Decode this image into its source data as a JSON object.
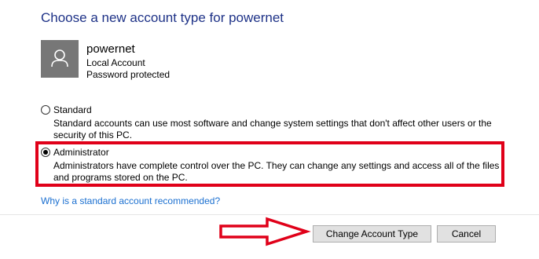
{
  "page": {
    "title": "Choose a new account type for powernet"
  },
  "user": {
    "name": "powernet",
    "account_type": "Local Account",
    "password_status": "Password protected",
    "avatar_icon": "user-silhouette-icon"
  },
  "options": {
    "standard": {
      "label": "Standard",
      "description": "Standard accounts can use most software and change system settings that don't affect other users or the security of this PC.",
      "selected": false
    },
    "administrator": {
      "label": "Administrator",
      "description": "Administrators have complete control over the PC. They can change any settings and access all of the files and programs stored on the PC.",
      "selected": true
    }
  },
  "link": {
    "text": "Why is a standard account recommended?"
  },
  "buttons": {
    "change_account_type": "Change Account Type",
    "cancel": "Cancel"
  },
  "annotations": {
    "highlight_color": "#e00019",
    "arrow_icon": "right-arrow-icon"
  },
  "colors": {
    "title": "#1e3287",
    "link": "#1a6fd0",
    "avatar_bg": "#777777"
  }
}
